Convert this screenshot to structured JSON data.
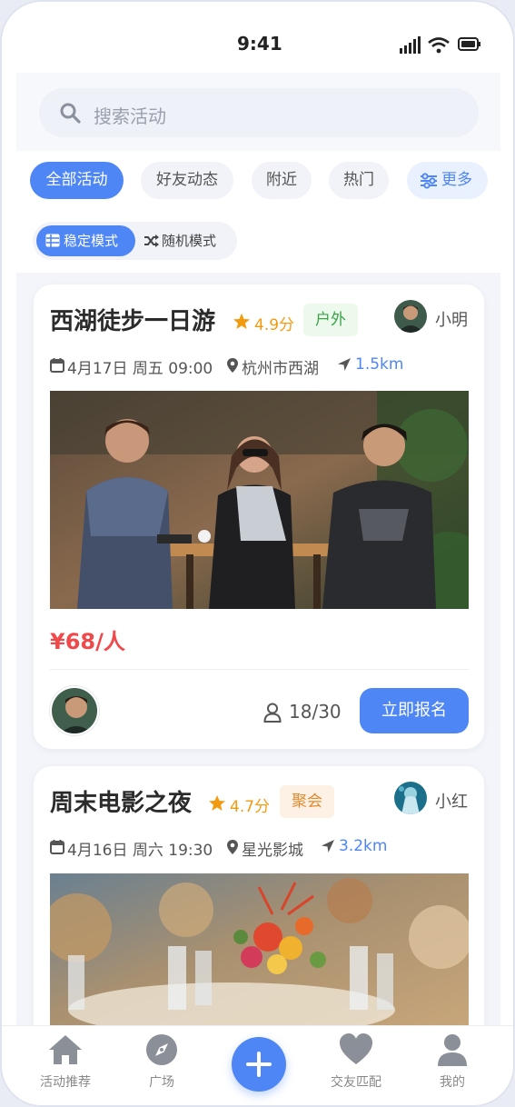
{
  "status_bar": {
    "time": "9:41"
  },
  "search": {
    "placeholder": "搜索活动"
  },
  "filters": [
    {
      "label": "全部活动",
      "active": true
    },
    {
      "label": "好友动态",
      "active": false
    },
    {
      "label": "附近",
      "active": false
    },
    {
      "label": "热门",
      "active": false
    },
    {
      "label": "更多",
      "active": false
    }
  ],
  "modes": [
    {
      "label": "稳定模式",
      "active": true
    },
    {
      "label": "随机模式",
      "active": false
    }
  ],
  "activities": [
    {
      "title": "西湖徒步一日游",
      "rating": "4.9分",
      "tag": "户外",
      "host": "小明",
      "date": "4月17日 周五 09:00",
      "location": "杭州市西湖",
      "distance": "1.5km",
      "price": "¥68/人",
      "attendance": "18/30",
      "cta": "立即报名"
    },
    {
      "title": "周末电影之夜",
      "rating": "4.7分",
      "tag": "聚会",
      "host": "小红",
      "date": "4月16日 周六 19:30",
      "location": "星光影城",
      "distance": "3.2km"
    }
  ],
  "tabs": [
    {
      "label": "活动推荐",
      "icon": "home-icon"
    },
    {
      "label": "广场",
      "icon": "compass-icon"
    },
    {
      "label": "",
      "icon": "plus-icon"
    },
    {
      "label": "交友匹配",
      "icon": "heart-icon"
    },
    {
      "label": "我的",
      "icon": "user-icon"
    }
  ],
  "colors": {
    "accent": "#4e86f5",
    "price": "#f0494b",
    "rating": "#f29b10"
  }
}
